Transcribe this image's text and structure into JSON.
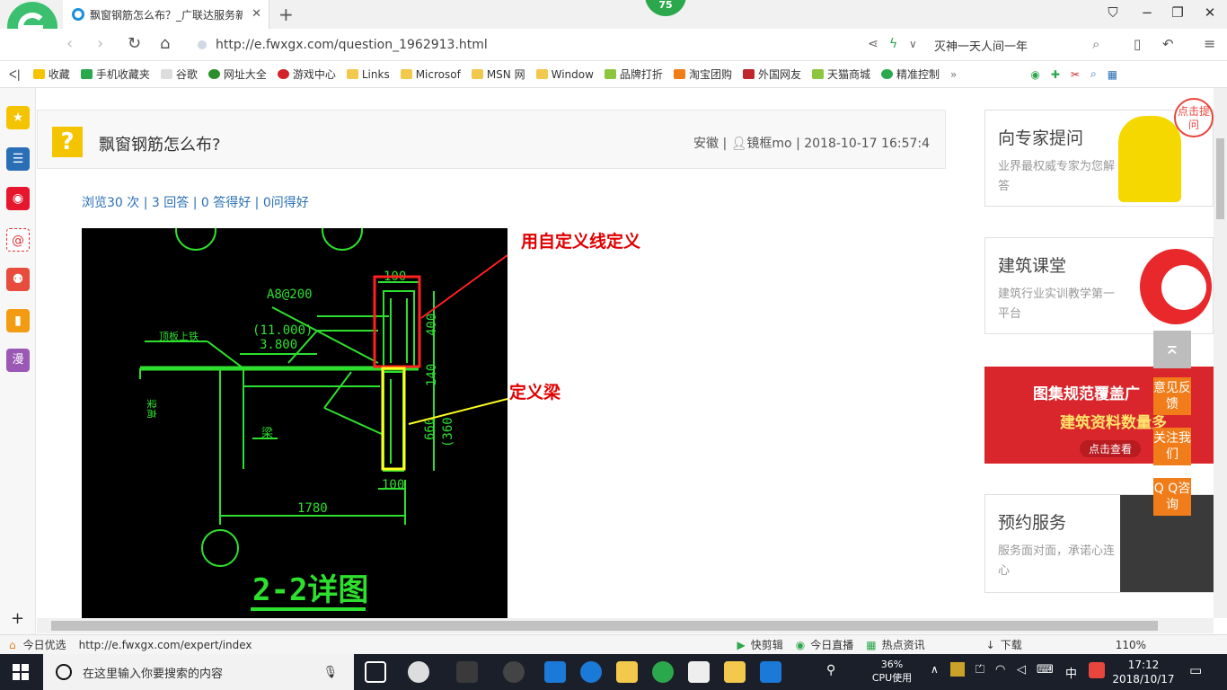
{
  "browser": {
    "tab_title": "飘窗钢筋怎么布？_广联达服务新",
    "badge": "75",
    "url": "http://e.fwxgx.com/question_1962913.html",
    "search_text": "灭神一天人间一年"
  },
  "bookmarks": [
    "收藏",
    "手机收藏夹",
    "谷歌",
    "网址大全",
    "游戏中心",
    "Links",
    "Microsof",
    "MSN 网",
    "Window",
    "品牌打折",
    "淘宝团购",
    "外国网友",
    "天猫商城",
    "精准控制"
  ],
  "question": {
    "title": "飘窗钢筋怎么布?",
    "region": "安徽",
    "sep1": "|",
    "user": "镜框mo",
    "sep2": "|",
    "time": "2018-10-17 16:57:4",
    "stats": "浏览30 次 | 3 回答 | 0 答得好 | 0问得好"
  },
  "annotations": {
    "red": "用自定义线定义",
    "yellow": "定义梁"
  },
  "cad": {
    "dim_top": "100",
    "rebar": "A8@200",
    "roof_label": "顶板上铁",
    "elev1": "(11.000)",
    "elev2": "3.800",
    "dim_400": "400",
    "dim_140": "140",
    "dim_660": "660",
    "dim_360": "(360",
    "beam": "梁",
    "dim_bottom": "100",
    "dim_1780": "1780",
    "side_label": "梁高",
    "detail": "2-2详图"
  },
  "sidebar_right": {
    "expert": {
      "title": "向专家提问",
      "sub": "业界最权威专家为您解答",
      "bubble": "点击提问"
    },
    "class": {
      "title": "建筑课堂",
      "sub": "建筑行业实训教学第一平台"
    },
    "promo": {
      "line1": "图集规范覆盖广",
      "line2": "建筑资料数量多",
      "btn": "点击查看"
    },
    "service": {
      "title": "预约服务",
      "sub": "服务面对面，承诺心连心"
    }
  },
  "float_buttons": [
    "意见反馈",
    "关注我们",
    "Q Q咨询"
  ],
  "status": {
    "left": "今日优选",
    "url": "http://e.fwxgx.com/expert/index",
    "items": [
      "快剪辑",
      "今日直播",
      "热点资讯",
      "下载"
    ],
    "zoom": "110%"
  },
  "taskbar": {
    "search_placeholder": "在这里输入你要搜索的内容",
    "cpu_pct": "36%",
    "cpu_label": "CPU使用",
    "ime": "中",
    "time": "17:12",
    "date": "2018/10/17"
  }
}
